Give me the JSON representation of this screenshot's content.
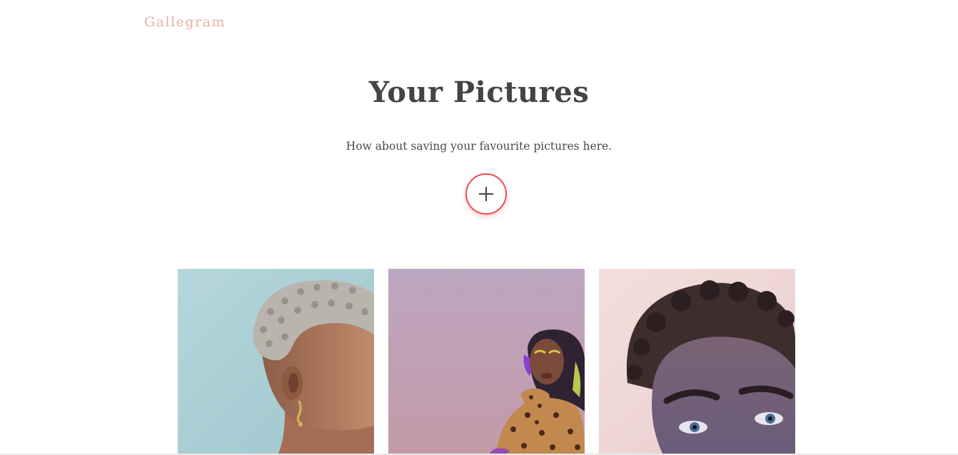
{
  "nav": {
    "brand": "Gallegram"
  },
  "hero": {
    "title": "Your Pictures",
    "subtitle": "How about saving your favourite pictures here."
  },
  "add_button": {
    "icon": "plus-icon",
    "border_color": "#ef4a4a"
  },
  "gallery": {
    "photos": [
      {
        "subject": "woman-short-curly-hair-profile",
        "background": "#a9cdd3"
      },
      {
        "subject": "woman-purple-hair-leopard-print",
        "background": "#b9a2bd"
      },
      {
        "subject": "young-man-curly-hair-portrait",
        "background": "#eed8d6"
      }
    ]
  },
  "colors": {
    "brand": "#eab0a3",
    "heading": "#444444",
    "text": "#4a4a4a",
    "accent": "#ef4a4a"
  }
}
